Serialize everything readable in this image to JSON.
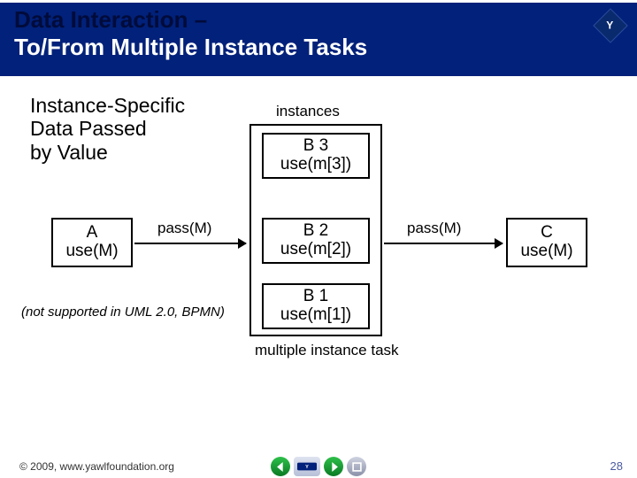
{
  "header": {
    "title_line1": "Data Interaction –",
    "title_line2": "To/From Multiple Instance Tasks",
    "logo_glyph": "Y"
  },
  "subtitle": {
    "line1": "Instance-Specific",
    "line2": "Data Passed",
    "line3": "by Value"
  },
  "labels": {
    "instances": "instances",
    "mit": "multiple instance task",
    "pass1": "pass(M)",
    "pass2": "pass(M)",
    "note": "(not supported in UML 2.0, BPMN)"
  },
  "tasks": {
    "A": {
      "name": "A",
      "use": "use(M)"
    },
    "C": {
      "name": "C",
      "use": "use(M)"
    },
    "B3": {
      "name": "B 3",
      "use": "use(m[3])"
    },
    "B2": {
      "name": "B 2",
      "use": "use(m[2])"
    },
    "B1": {
      "name": "B 1",
      "use": "use(m[1])"
    }
  },
  "footer": {
    "copyright": "© 2009, www.yawlfoundation.org",
    "page": "28"
  },
  "colors": {
    "brand_navy": "#01217a"
  }
}
